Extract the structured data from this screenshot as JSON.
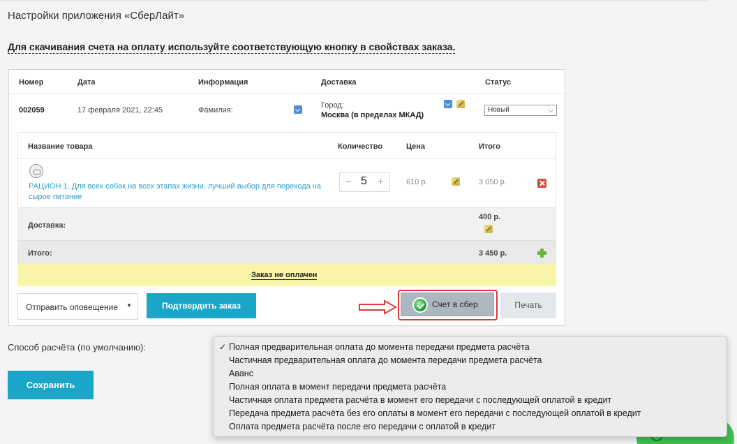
{
  "page": {
    "title": "Настройки приложения «СберЛайт»",
    "notice": "Для скачивания счета на оплату используйте соответствующую кнопку в свойствах заказа."
  },
  "order": {
    "headers": {
      "number": "Номер",
      "date": "Дата",
      "info": "Информация",
      "delivery": "Доставка",
      "status": "Статус"
    },
    "number": "002059",
    "date": "17 февраля 2021, 22:45",
    "info_label": "Фамилия:",
    "city_label": "Город:",
    "city_value": "Москва (в пределах МКАД)",
    "status_value": "Новый"
  },
  "items": {
    "headers": {
      "name": "Название товара",
      "qty": "Количество",
      "price": "Цена",
      "total": "Итого"
    },
    "rows": [
      {
        "name": "РАЦИОН 1. Для всех собак на всех этапах жизни, лучший выбор для перехода на сырое питание",
        "qty": "5",
        "price": "610 р.",
        "total": "3 050 р."
      }
    ],
    "delivery_label": "Доставка:",
    "delivery_value": "400 р.",
    "total_label": "Итого:",
    "total_value": "3 450 р."
  },
  "payment_status": "Заказ не оплачен",
  "actions": {
    "notify": "Отправить оповещение",
    "confirm": "Подтвердить заказ",
    "sber": "Счет в сбер",
    "print": "Печать"
  },
  "settings": {
    "payment_method_label": "Способ расчёта (по умолчанию):",
    "save": "Сохранить",
    "selected_mark": "✓",
    "options": [
      "Полная предварительная оплата до момента передачи предмета расчёта",
      "Частичная предварительная оплата до момента передачи предмета расчёта",
      "Аванс",
      "Полная оплата в момент передачи предмета расчёта",
      "Частичная оплата предмета расчёта в момент его передачи с последующей оплатой в кредит",
      "Передача предмета расчёта без его оплаты в момент его передачи с последующей оплатой в кредит",
      "Оплата предмета расчёта после его передачи с оплатой в кредит"
    ]
  },
  "colors": {
    "accent": "#1ba5c9",
    "link": "#2a9fc7",
    "unpaid": "#f8f4a8",
    "highlight": "#d93a3a",
    "sber": "#21a038"
  },
  "icons": [
    "expand-icon",
    "edit-icon",
    "delete-icon",
    "add-icon",
    "sber-logo-icon",
    "arrow-right-icon",
    "product-thumb-icon"
  ]
}
